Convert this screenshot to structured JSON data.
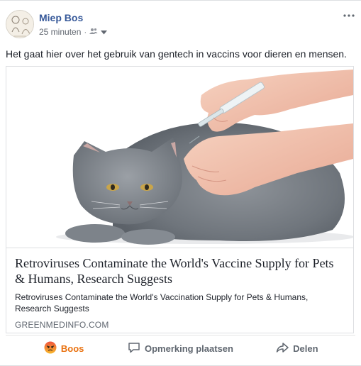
{
  "post": {
    "author": "Miep Bos",
    "timestamp": "25 minuten",
    "meta_dot": "·",
    "audience_icon": "friends-icon",
    "text": "Het gaat hier over het gebruik van gentech in vaccins voor dieren en mensen."
  },
  "link": {
    "image_icon": "cat-injection-photo",
    "title": "Retroviruses Contaminate the World's Vaccine Supply for Pets & Humans, Research Suggests",
    "description": "Retroviruses Contaminate the World's Vaccination Supply for Pets & Humans, Research Suggests",
    "domain": "GREENMEDINFO.COM"
  },
  "actions": {
    "react_label": "Boos",
    "react_icon": "angry-emoji-icon",
    "comment_label": "Opmerking plaatsen",
    "comment_icon": "comment-icon",
    "share_label": "Delen",
    "share_icon": "share-icon"
  },
  "colors": {
    "author_link": "#365899",
    "angry_reaction": "#e9710f",
    "meta_text": "#616770"
  }
}
